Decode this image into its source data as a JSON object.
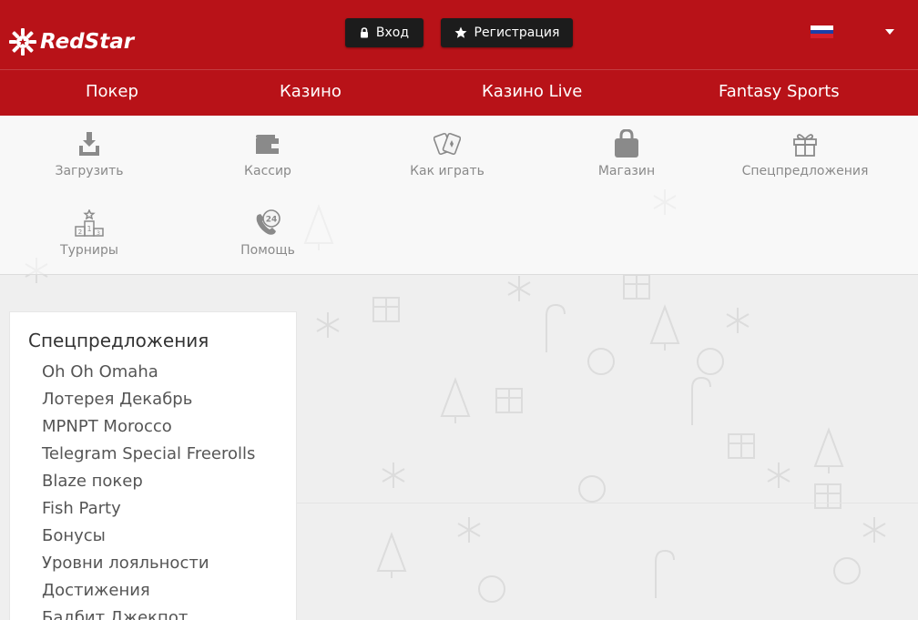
{
  "brand": {
    "name": "RedStar"
  },
  "colors": {
    "header": "#b81218",
    "button": "#1c1c1c",
    "text": "#333333",
    "muted": "#8a8a8a"
  },
  "header": {
    "login_label": "Вход",
    "register_label": "Регистрация",
    "language": "ru-flag-icon"
  },
  "nav": {
    "items": [
      {
        "label": "Покер"
      },
      {
        "label": "Казино"
      },
      {
        "label": "Казино Live"
      },
      {
        "label": "Fantasy Sports"
      }
    ]
  },
  "iconmenu": {
    "items": [
      {
        "label": "Загрузить",
        "icon": "download-icon"
      },
      {
        "label": "Кассир",
        "icon": "wallet-icon"
      },
      {
        "label": "Как играть",
        "icon": "cards-icon"
      },
      {
        "label": "Магазин",
        "icon": "shopping-bag-icon"
      },
      {
        "label": "Спецпредложения",
        "icon": "gift-icon"
      },
      {
        "label": "Турниры",
        "icon": "podium-icon"
      },
      {
        "label": "Помощь",
        "icon": "support-24-icon"
      }
    ]
  },
  "sidebar": {
    "title": "Спецпредложения",
    "items": [
      "Oh Oh Omaha",
      "Лотерея Декабрь",
      "MPNPT Morocco",
      "Telegram Special Freerolls",
      "Blaze покер",
      "Fish Party",
      "Бонусы",
      "Уровни лояльности",
      "Достижения",
      "Бадбит Джекпот"
    ]
  }
}
